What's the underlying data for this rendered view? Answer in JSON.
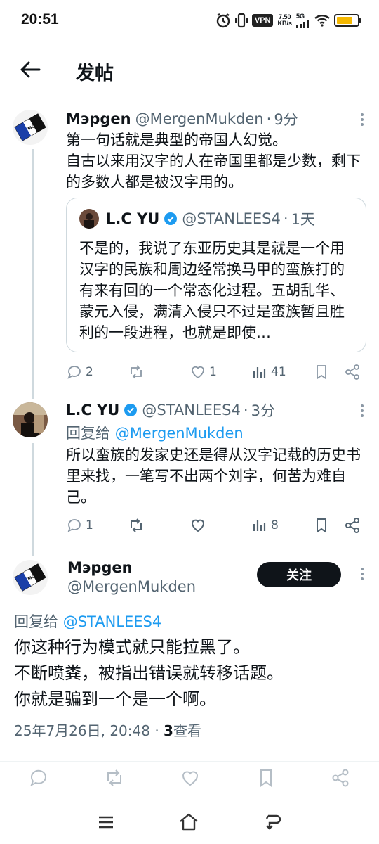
{
  "status_bar": {
    "time": "20:51",
    "vpn": "VPN",
    "net_speed_value": "7.50",
    "net_speed_unit": "KB/s",
    "network": "5G"
  },
  "header": {
    "title": "发帖"
  },
  "tweets": [
    {
      "name": "Мэрgen",
      "handle": "@MergenMukden",
      "time": "9分",
      "text_lines": [
        "第一句话就是典型的帝国人幻觉。",
        "自古以来用汉字的人在帝国里都是少数，剩下的多数人都是被汉字用的。"
      ],
      "quote": {
        "name": "L.C YU",
        "handle": "@STANLEES4",
        "time": "1天",
        "text": "不是的，我说了东亚历史其是就是一个用汉字的民族和周边经常换马甲的蛮族打的有来有回的一个常态化过程。五胡乱华、蒙元入侵，满清入侵只不过是蛮族暂且胜利的一段进程，也就是即使…"
      },
      "replies": "2",
      "retweets": "",
      "likes": "1",
      "views": "41"
    },
    {
      "name": "L.C YU",
      "handle": "@STANLEES4",
      "time": "3分",
      "reply_prefix": "回复给 ",
      "reply_to": "@MergenMukden",
      "text": "所以蛮族的发家史还是得从汉字记载的历史书里来找，一笔写不出两个刘字，何苦为难自己。",
      "replies": "1",
      "retweets": "",
      "likes": "",
      "views": "8"
    }
  ],
  "main_tweet": {
    "name": "Мэрgen",
    "handle": "@MergenMukden",
    "follow_label": "关注",
    "reply_prefix": "回复给 ",
    "reply_to": "@STANLEES4",
    "text_lines": [
      "你这种行为模式就只能拉黑了。",
      "不断喷粪，被指出错误就转移话题。",
      "你就是骗到一个是一个啊。"
    ],
    "date": "25年7月26日, 20:48 · ",
    "views_count": "3",
    "views_label": "查看"
  },
  "avatar_badge_text": "MONO",
  "colors": {
    "accent": "#1d9bf0",
    "text": "#0f1419",
    "muted": "#536471",
    "verified": "#1d9bf0",
    "battery": "#f5b800"
  }
}
